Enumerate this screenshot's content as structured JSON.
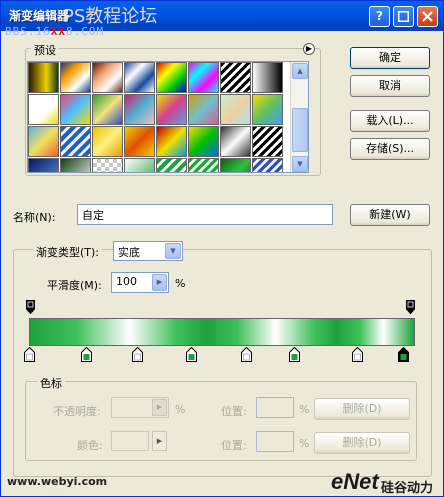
{
  "window": {
    "title": "渐变编辑器",
    "watermark_text": "PS教程论坛",
    "watermark_red": "XX",
    "watermark_url": "BBS.16XX8.COM"
  },
  "presets": {
    "label": "预设"
  },
  "buttons": {
    "ok": "确定",
    "cancel": "取消",
    "load": "载入(L)...",
    "save": "存储(S)...",
    "new": "新建(W)"
  },
  "name_field": {
    "label": "名称(N):",
    "value": "自定"
  },
  "gradient_type": {
    "label": "渐变类型(T):",
    "value": "实底"
  },
  "smoothness": {
    "label": "平滑度(M):",
    "value": "100",
    "unit": "%"
  },
  "color_stops": {
    "group_label": "色标",
    "opacity_label": "不透明度:",
    "opacity_unit": "%",
    "location_label": "位置:",
    "location_unit": "%",
    "delete_label": "删除(D)",
    "color_label": "颜色:"
  },
  "footer": {
    "left_watermark": "www.webyi.com",
    "right_watermark_brand": "eNet",
    "right_watermark_cn": "硅谷动力"
  },
  "colors": {
    "title_blue": "#0054e3",
    "dialog_bg": "#ece9d8",
    "gradient_green": "#1ea23c"
  }
}
